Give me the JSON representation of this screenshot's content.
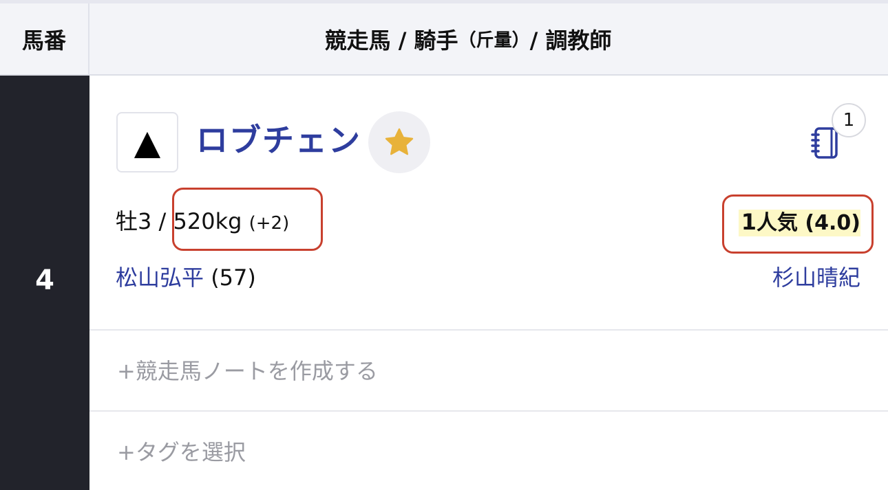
{
  "header": {
    "col_number": "馬番",
    "col_main_part1": "競走馬 / 騎手",
    "col_main_part2": "（斤量）",
    "col_main_part3": "/ 調教師"
  },
  "entry": {
    "number": "4",
    "mark": "▲",
    "horse_name": "ロブチェン",
    "favorite_icon": "star-icon",
    "note_icon": "notebook-icon",
    "note_count": "1",
    "sex_age": "牡3",
    "separator": " / ",
    "weight": "520kg",
    "weight_diff": "(+2)",
    "popularity_rank": "1",
    "popularity_label": "人気",
    "odds": "(4.0)",
    "jockey": "松山弘平",
    "jockey_weight": "(57)",
    "trainer": "杉山晴紀"
  },
  "actions": {
    "create_note": "+競走馬ノートを作成する",
    "select_tag": "+タグを選択"
  },
  "colors": {
    "accent": "#2e3d9e",
    "number_bg": "#22232b",
    "highlight": "#fdf8c6",
    "annotation": "#c8402e",
    "star": "#e8b23a"
  }
}
